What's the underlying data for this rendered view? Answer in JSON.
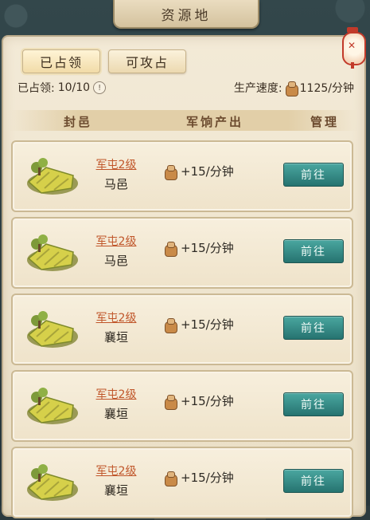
{
  "window": {
    "title": "资源地"
  },
  "tabs": [
    {
      "label": "已占领",
      "active": true
    },
    {
      "label": "可攻占",
      "active": false
    }
  ],
  "summary": {
    "occupied_label": "已占领:",
    "occupied_value": "10/10",
    "speed_label": "生产速度:",
    "speed_value": "1125/分钟"
  },
  "table": {
    "headers": [
      "封邑",
      "军饷产出",
      "管理"
    ],
    "rows": [
      {
        "level": "军屯2级",
        "name": "马邑",
        "output": "+15/分钟",
        "action": "前往"
      },
      {
        "level": "军屯2级",
        "name": "马邑",
        "output": "+15/分钟",
        "action": "前往"
      },
      {
        "level": "军屯2级",
        "name": "襄垣",
        "output": "+15/分钟",
        "action": "前往"
      },
      {
        "level": "军屯2级",
        "name": "襄垣",
        "output": "+15/分钟",
        "action": "前往"
      },
      {
        "level": "军屯2级",
        "name": "襄垣",
        "output": "+15/分钟",
        "action": "前往"
      }
    ]
  },
  "icons": {
    "resource": "coin-sack-icon",
    "info": "info-icon",
    "terrain": "farmland-terrain-icon",
    "lantern": "lantern-icon"
  },
  "colors": {
    "accent_button": "#267370",
    "level_text": "#c0562a",
    "panel_bg": "#f3ead7"
  }
}
